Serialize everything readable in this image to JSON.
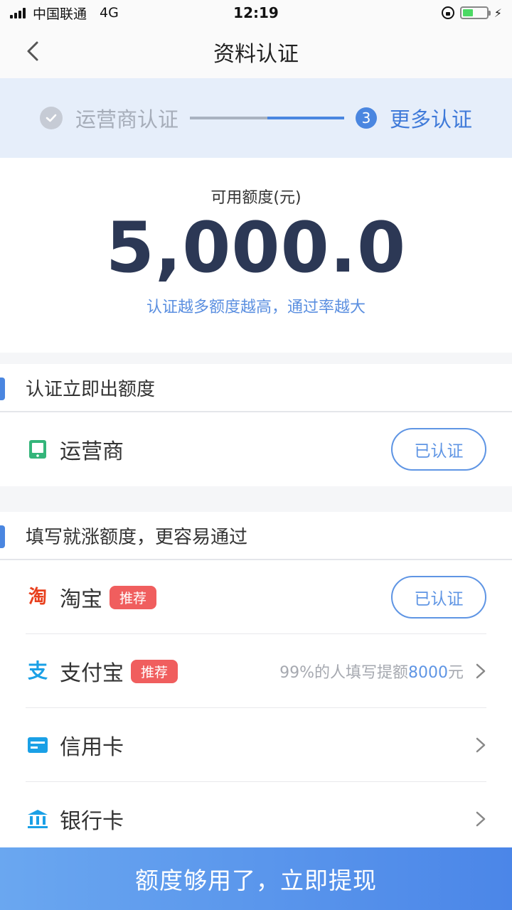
{
  "status_bar": {
    "carrier": "中国联通",
    "network": "4G",
    "time": "12:19",
    "battery_level": 0.45
  },
  "nav": {
    "title": "资料认证"
  },
  "steps": {
    "done_label": "运营商认证",
    "current_number": "3",
    "current_label": "更多认证"
  },
  "quota": {
    "label": "可用额度(元)",
    "amount": "5,000.0",
    "hint": "认证越多额度越高，通过率越大"
  },
  "section_instant": {
    "title": "认证立即出额度",
    "items": [
      {
        "icon": "phone-icon",
        "label": "运营商",
        "status": "已认证"
      }
    ]
  },
  "section_optional": {
    "title": "填写就涨额度，更容易通过",
    "items": [
      {
        "icon": "taobao-icon",
        "label": "淘宝",
        "badge": "推荐",
        "status": "已认证"
      },
      {
        "icon": "alipay-icon",
        "label": "支付宝",
        "badge": "推荐",
        "hint_prefix": "99%的人填写提额",
        "hint_highlight": "8000",
        "hint_suffix": "元"
      },
      {
        "icon": "credit-card-icon",
        "label": "信用卡"
      },
      {
        "icon": "bank-icon",
        "label": "银行卡"
      }
    ]
  },
  "bottom_button": {
    "label": "额度够用了，立即提现"
  },
  "colors": {
    "primary": "#4a86e0",
    "badge": "#f05e5e",
    "amount": "#2c3855",
    "green": "#34b57a",
    "taobao": "#e8401e",
    "alipay": "#1aa0e6"
  }
}
